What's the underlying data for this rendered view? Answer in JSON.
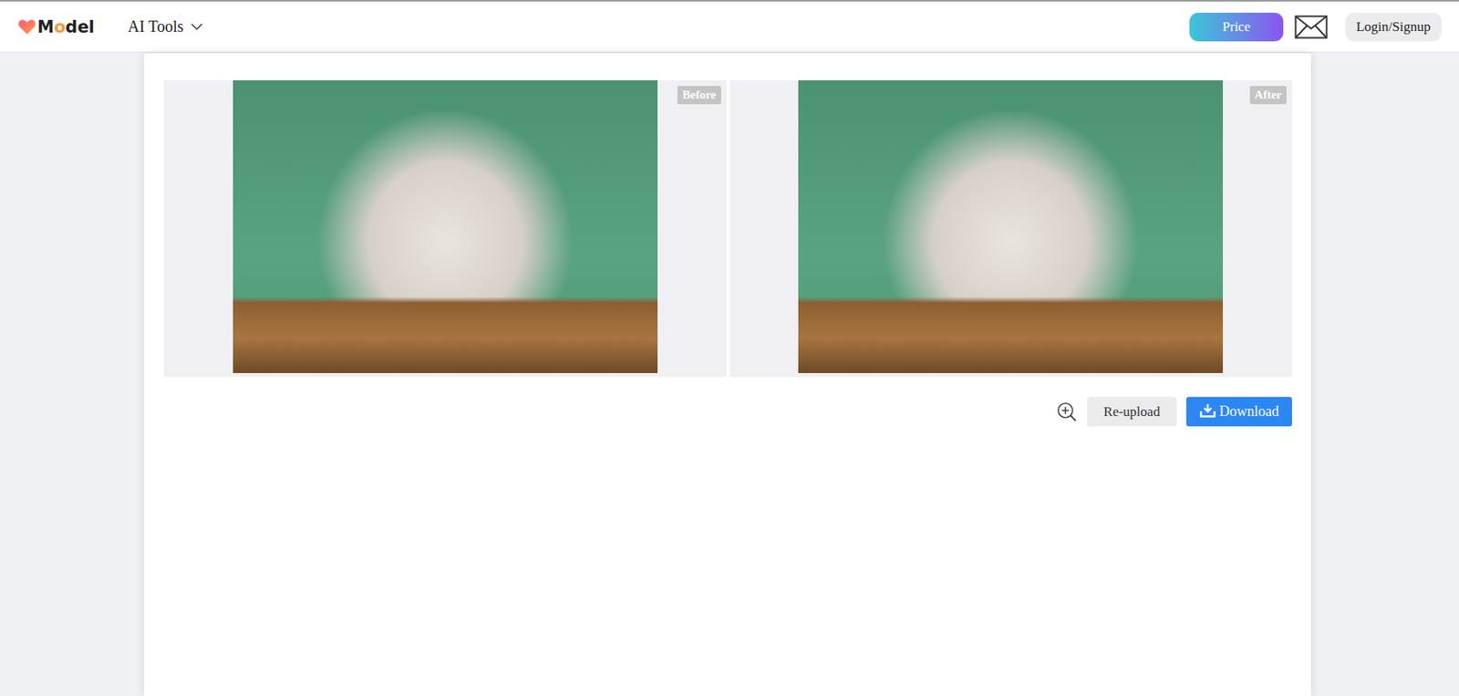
{
  "nav": {
    "logo": [
      {
        "text": "M",
        "accent": false
      },
      {
        "text": "o",
        "accent": true
      },
      {
        "text": "del",
        "accent": false
      }
    ],
    "menu": {
      "label": "AI Tools",
      "expanded": false
    },
    "price_button": "Price",
    "login_button": "Login/Signup"
  },
  "compare": [
    {
      "badge": "Before"
    },
    {
      "badge": "After"
    }
  ],
  "actions": {
    "reupload": "Re-upload",
    "download": "Download"
  }
}
